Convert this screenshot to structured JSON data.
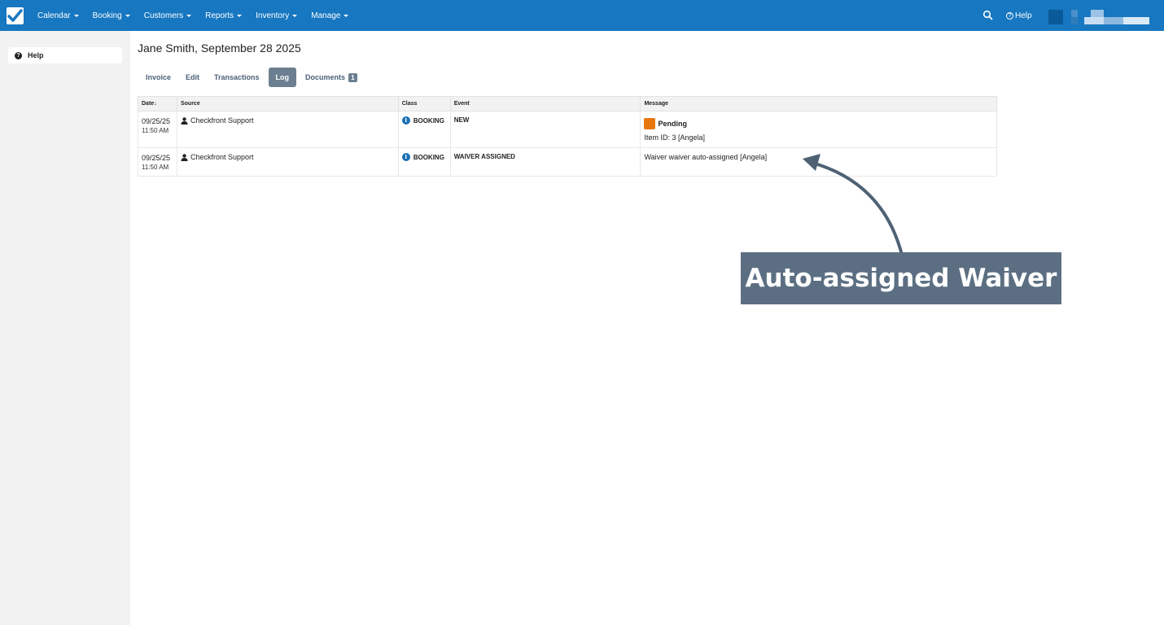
{
  "nav": {
    "items": [
      {
        "label": "Calendar"
      },
      {
        "label": "Booking"
      },
      {
        "label": "Customers"
      },
      {
        "label": "Reports"
      },
      {
        "label": "Inventory"
      },
      {
        "label": "Manage"
      }
    ],
    "help_label": "Help",
    "color": "#1777c0"
  },
  "sidebar": {
    "help_label": "Help"
  },
  "page": {
    "title": "Jane Smith, September 28 2025"
  },
  "tabs": [
    {
      "label": "Invoice",
      "active": false
    },
    {
      "label": "Edit",
      "active": false
    },
    {
      "label": "Transactions",
      "active": false
    },
    {
      "label": "Log",
      "active": true
    },
    {
      "label": "Documents",
      "active": false,
      "badge": "1"
    }
  ],
  "log_table": {
    "headers": [
      "Date",
      "Source",
      "Class",
      "Event",
      "Message"
    ],
    "sort_indicator": "↓",
    "rows": [
      {
        "date": "09/25/25",
        "time": "11:50 AM",
        "source": "Checkfront Support",
        "class": "BOOKING",
        "event": "NEW",
        "status_label": "Pending",
        "status_color": "#e8760f",
        "message": "Item ID: 3 [Angela]"
      },
      {
        "date": "09/25/25",
        "time": "11:50 AM",
        "source": "Checkfront Support",
        "class": "BOOKING",
        "event": "WAIVER ASSIGNED",
        "message": "Waiver waiver auto-assigned [Angela]"
      }
    ]
  },
  "annotation": {
    "label": "Auto-assigned Waiver",
    "color": "#5c6f82"
  }
}
